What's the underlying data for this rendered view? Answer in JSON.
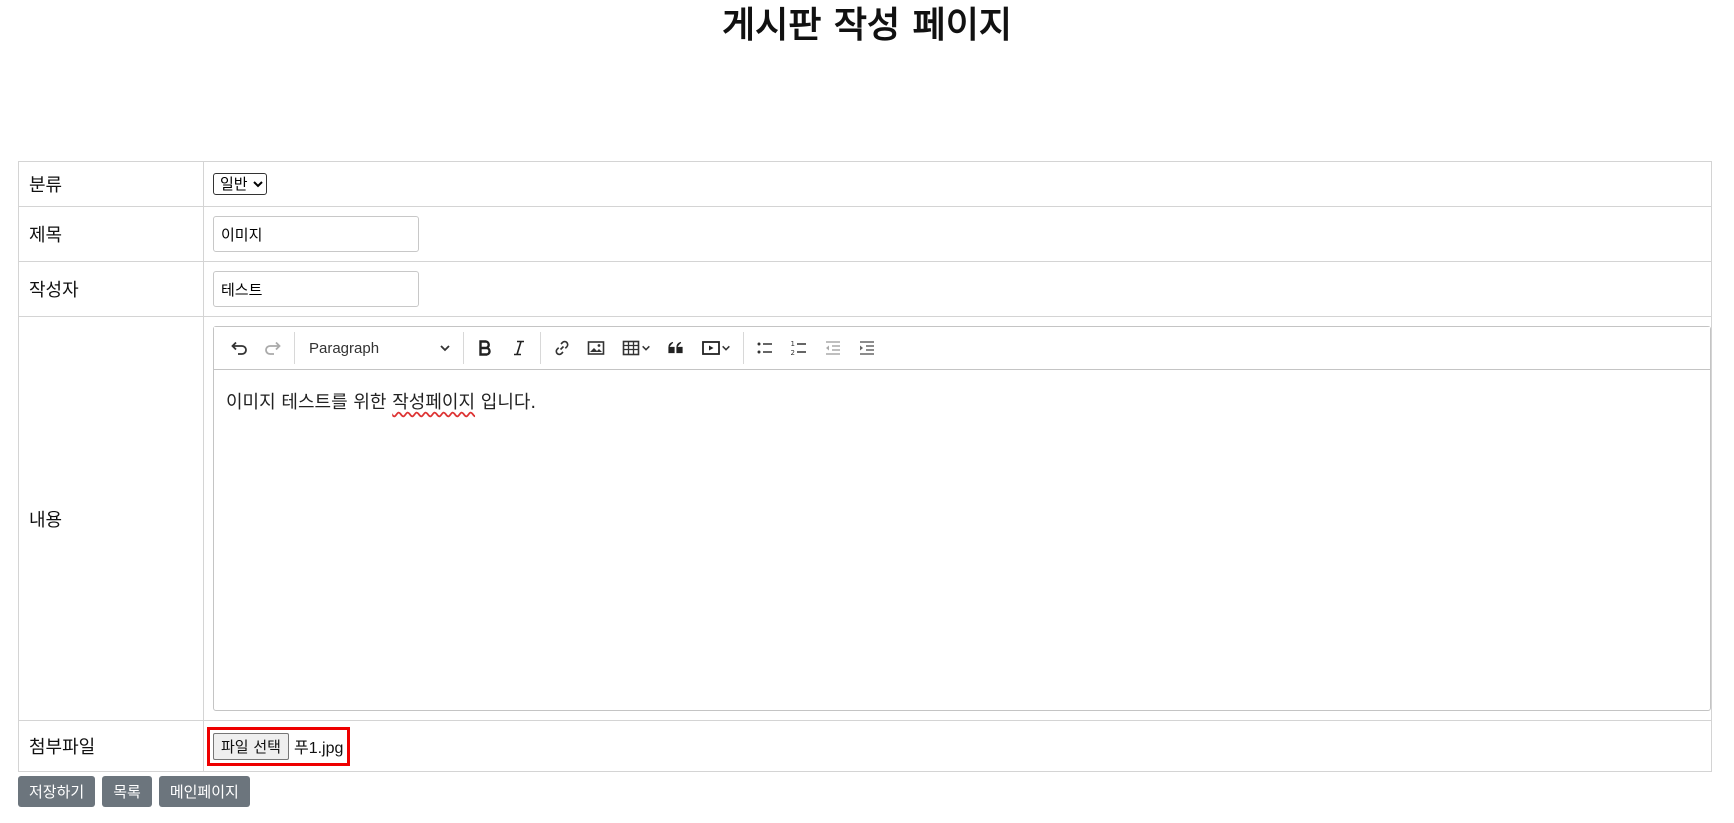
{
  "page": {
    "title": "게시판 작성 페이지"
  },
  "form": {
    "category": {
      "label": "분류",
      "selected": "일반"
    },
    "title": {
      "label": "제목",
      "value": "이미지"
    },
    "author": {
      "label": "작성자",
      "value": "테스트"
    },
    "content": {
      "label": "내용",
      "toolbar": {
        "heading": "Paragraph",
        "icons": [
          "undo-icon",
          "redo-icon",
          "bold-icon",
          "italic-icon",
          "link-icon",
          "image-icon",
          "table-icon",
          "blockquote-icon",
          "media-icon",
          "bulleted-list-icon",
          "numbered-list-icon",
          "outdent-icon",
          "indent-icon"
        ]
      },
      "text_before": "이미지 테스트를 위한 ",
      "text_misspelled": "작성페이지",
      "text_after": " 입니다."
    },
    "attachment": {
      "label": "첨부파일",
      "button": "파일 선택",
      "file_name": "푸1.jpg",
      "highlight_color": "#e00000"
    }
  },
  "actions": {
    "save": "저장하기",
    "list": "목록",
    "main": "메인페이지"
  },
  "colors": {
    "button_bg": "#6c757d",
    "button_text": "#ffffff"
  }
}
